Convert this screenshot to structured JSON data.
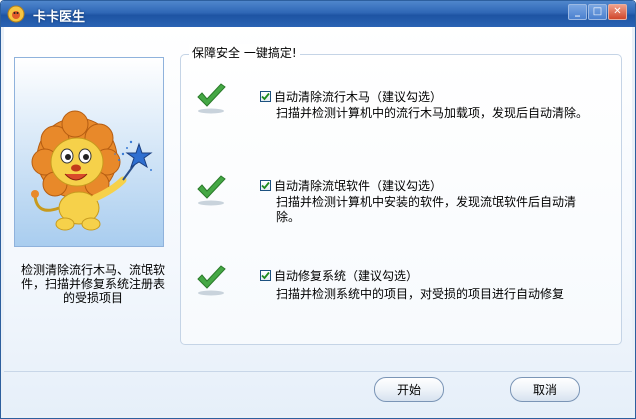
{
  "window": {
    "title": "卡卡医生"
  },
  "left": {
    "description": "检测清除流行木马、流氓软件，扫描并修复系统注册表的受损项目"
  },
  "group": {
    "title": "保障安全 一键搞定!"
  },
  "options": [
    {
      "label": "自动清除流行木马（建议勾选）",
      "description": "扫描并检测计算机中的流行木马加载项，发现后自动清除。",
      "checked": true
    },
    {
      "label": "自动清除流氓软件（建议勾选）",
      "description": "扫描并检测计算机中安装的软件，发现流氓软件后自动清除。",
      "checked": true
    },
    {
      "label": "自动修复系统（建议勾选）",
      "description": "扫描并检测系统中的项目，对受损的项目进行自动修复",
      "checked": true
    }
  ],
  "buttons": {
    "start": "开始",
    "cancel": "取消"
  },
  "colors": {
    "titlebar": "#2f67b6",
    "check_green": "#3a9b3a",
    "panel_border": "#8fb2dc"
  }
}
